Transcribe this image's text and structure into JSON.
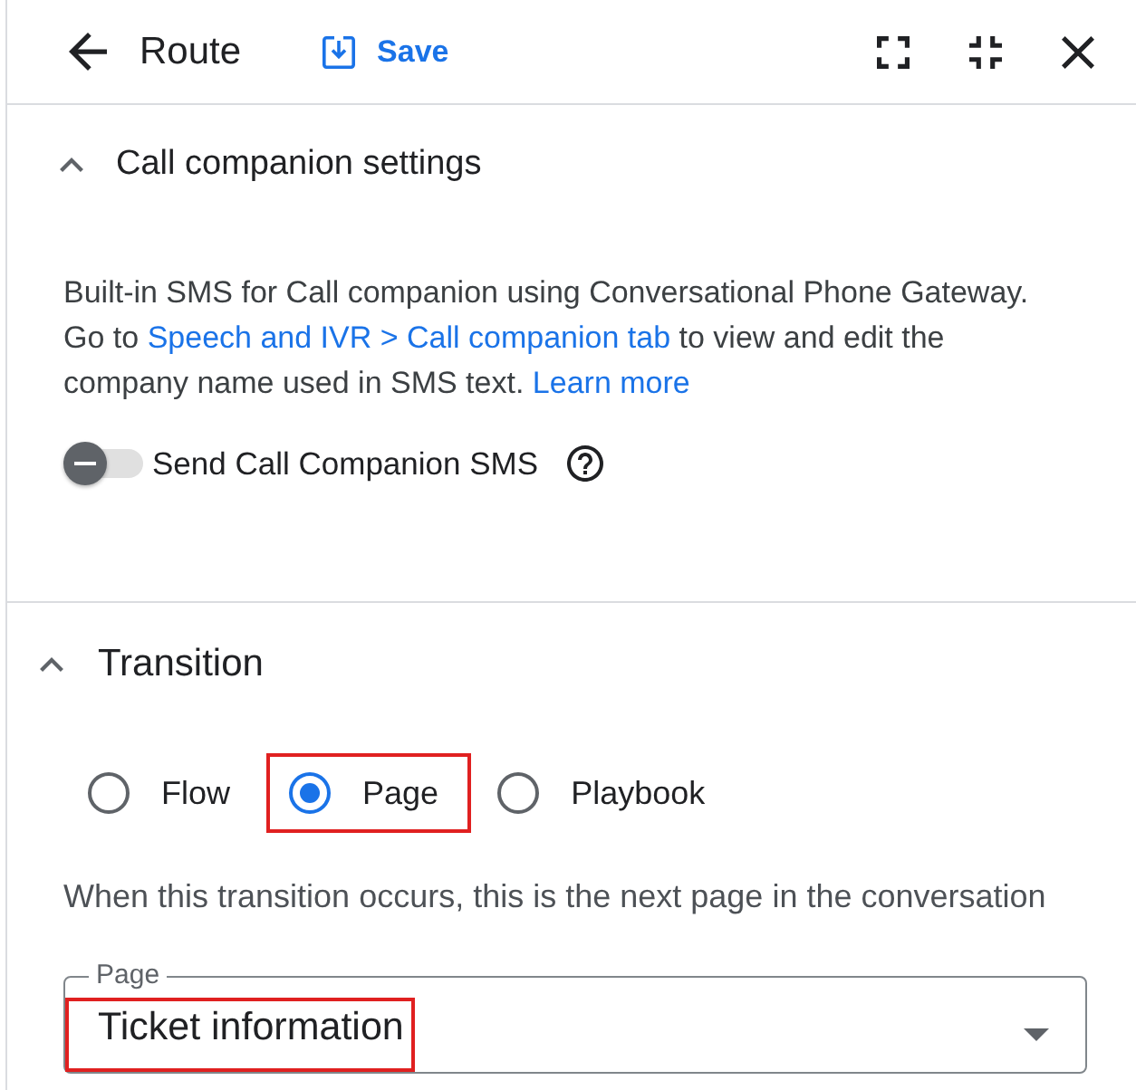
{
  "header": {
    "title": "Route",
    "save_label": "Save"
  },
  "call_companion": {
    "title": "Call companion settings",
    "expanded": true,
    "description": [
      {
        "kind": "text",
        "text": "Built-in SMS for Call companion using Conversational Phone Gateway. Go to"
      },
      {
        "kind": "link",
        "text": "Speech and IVR > Call companion tab"
      },
      {
        "kind": "text",
        "text": "to view and edit the company name used in SMS text."
      },
      {
        "kind": "link",
        "text": "Learn more"
      }
    ],
    "toggle": {
      "label": "Send Call Companion SMS",
      "on": false
    }
  },
  "transition": {
    "title": "Transition",
    "expanded": true,
    "options": [
      {
        "label": "Flow",
        "selected": false,
        "highlighted": false
      },
      {
        "label": "Page",
        "selected": true,
        "highlighted": true
      },
      {
        "label": "Playbook",
        "selected": false,
        "highlighted": false
      }
    ],
    "hint": "When this transition occurs, this is the next page in the conversation",
    "page_field": {
      "label": "Page",
      "value": "Ticket information",
      "highlighted": true
    }
  }
}
